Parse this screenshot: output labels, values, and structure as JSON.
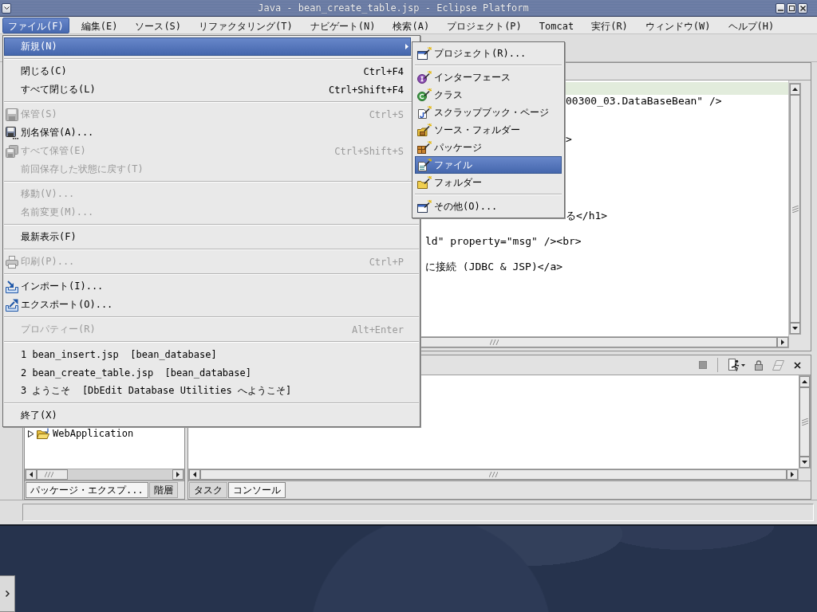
{
  "window": {
    "title": "Java - bean_create_table.jsp - Eclipse Platform"
  },
  "menu_bar": [
    {
      "label": "ファイル(F)",
      "selected": true
    },
    {
      "label": "編集(E)",
      "selected": false
    },
    {
      "label": "ソース(S)",
      "selected": false
    },
    {
      "label": "リファクタリング(T)",
      "selected": false
    },
    {
      "label": "ナビゲート(N)",
      "selected": false
    },
    {
      "label": "検索(A)",
      "selected": false
    },
    {
      "label": "プロジェクト(P)",
      "selected": false
    },
    {
      "label": "Tomcat",
      "selected": false
    },
    {
      "label": "実行(R)",
      "selected": false
    },
    {
      "label": "ウィンドウ(W)",
      "selected": false
    },
    {
      "label": "ヘルプ(H)",
      "selected": false
    }
  ],
  "file_menu": {
    "groups": [
      [
        {
          "kind": "submenu",
          "label": "新規(N)",
          "selected": true,
          "disabled": false
        }
      ],
      [
        {
          "kind": "plain",
          "label": "閉じる(C)",
          "shortcut": "Ctrl+F4",
          "selected": false,
          "disabled": false
        },
        {
          "kind": "plain",
          "label": "すべて閉じる(L)",
          "shortcut": "Ctrl+Shift+F4",
          "selected": false,
          "disabled": false
        }
      ],
      [
        {
          "kind": "save",
          "label": "保管(S)",
          "shortcut": "Ctrl+S",
          "selected": false,
          "disabled": true
        },
        {
          "kind": "save-as",
          "label": "別名保管(A)...",
          "selected": false,
          "disabled": false
        },
        {
          "kind": "save-all",
          "label": "すべて保管(E)",
          "shortcut": "Ctrl+Shift+S",
          "selected": false,
          "disabled": true
        },
        {
          "kind": "plain",
          "label": "前回保存した状態に戻す(T)",
          "selected": false,
          "disabled": true
        }
      ],
      [
        {
          "kind": "plain",
          "label": "移動(V)...",
          "selected": false,
          "disabled": true
        },
        {
          "kind": "plain",
          "label": "名前変更(M)...",
          "selected": false,
          "disabled": true
        }
      ],
      [
        {
          "kind": "plain",
          "label": "最新表示(F)",
          "selected": false,
          "disabled": false
        }
      ],
      [
        {
          "kind": "print",
          "label": "印刷(P)...",
          "shortcut": "Ctrl+P",
          "selected": false,
          "disabled": true
        }
      ],
      [
        {
          "kind": "import",
          "label": "インポート(I)...",
          "selected": false,
          "disabled": false
        },
        {
          "kind": "export",
          "label": "エクスポート(O)...",
          "selected": false,
          "disabled": false
        }
      ],
      [
        {
          "kind": "plain",
          "label": "プロパティー(R)",
          "shortcut": "Alt+Enter",
          "selected": false,
          "disabled": true
        }
      ],
      [
        {
          "kind": "plain",
          "label": "1 bean_insert.jsp  [bean_database]",
          "selected": false,
          "disabled": false
        },
        {
          "kind": "plain",
          "label": "2 bean_create_table.jsp  [bean_database]",
          "selected": false,
          "disabled": false
        },
        {
          "kind": "plain",
          "label": "3 ようこそ  [DbEdit Database Utilities へようこそ]",
          "selected": false,
          "disabled": false
        }
      ],
      [
        {
          "kind": "plain",
          "label": "終了(X)",
          "selected": false,
          "disabled": false
        }
      ]
    ]
  },
  "new_submenu": {
    "groups": [
      [
        {
          "kind": "project",
          "label": "プロジェクト(R)...",
          "selected": false
        }
      ],
      [
        {
          "kind": "interface",
          "label": "インターフェース",
          "selected": false
        },
        {
          "kind": "class",
          "label": "クラス",
          "selected": false
        },
        {
          "kind": "scrapbook",
          "label": "スクラップブック・ページ",
          "selected": false
        },
        {
          "kind": "source-folder",
          "label": "ソース・フォルダー",
          "selected": false
        },
        {
          "kind": "package",
          "label": "パッケージ",
          "selected": false
        },
        {
          "kind": "file",
          "label": "ファイル",
          "selected": true
        },
        {
          "kind": "folder",
          "label": "フォルダー",
          "selected": false
        }
      ],
      [
        {
          "kind": "other",
          "label": "その他(O)...",
          "selected": false
        }
      ]
    ]
  },
  "editor": {
    "highlight_current_line": true,
    "lines": [
      {
        "kind": "right-of-submenu",
        "text": "00300_03.DataBaseBean\" />"
      },
      {
        "kind": "right-of-submenu",
        "text": ">"
      },
      {
        "kind": "right-of-submenu",
        "text": "る</h1>"
      },
      {
        "kind": "right-of-file-menu",
        "text": "ld\" property=\"msg\" /><br>"
      },
      {
        "kind": "right-of-file-menu",
        "text": "に接続 (JDBC & JSP)</a>"
      }
    ]
  },
  "explorer": {
    "tree": [
      {
        "label": "WebApplication",
        "expanded": false
      }
    ],
    "tabs": [
      {
        "label": "パッケージ・エクスプ...",
        "selected": true
      },
      {
        "label": "階層",
        "selected": false
      }
    ]
  },
  "console": {
    "toolbar": [
      {
        "kind": "stop",
        "disabled": true
      },
      {
        "kind": "run",
        "disabled": false
      },
      {
        "kind": "lock",
        "disabled": false
      },
      {
        "kind": "clear",
        "disabled": true
      },
      {
        "kind": "close",
        "disabled": false
      }
    ],
    "tabs": [
      {
        "label": "タスク",
        "selected": false
      },
      {
        "label": "コンソール",
        "selected": true
      }
    ]
  }
}
